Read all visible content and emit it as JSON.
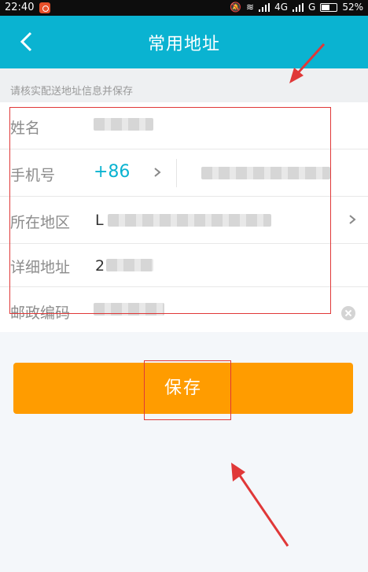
{
  "status_bar": {
    "time": "22:40",
    "network": "4G",
    "network2": "G",
    "battery": "52%"
  },
  "header": {
    "title": "常用地址",
    "back_icon": "chevron-left-icon"
  },
  "hint": "请核实配送地址信息并保存",
  "form": {
    "name_label": "姓名",
    "phone_label": "手机号",
    "country_code": "+86",
    "region_label": "所在地区",
    "region_value_first_char": "L",
    "detail_label": "详细地址",
    "detail_value_first_char": "2",
    "postal_label": "邮政编码"
  },
  "save_label": "保存",
  "colors": {
    "accent": "#0ab3d1",
    "button": "#ff9c00",
    "annotation": "#e03838"
  }
}
